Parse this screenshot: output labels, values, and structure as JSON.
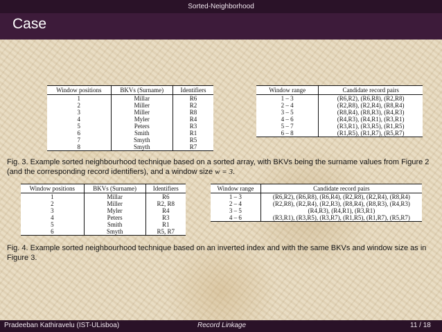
{
  "header": {
    "section": "Sorted-Neighborhood",
    "title": "Case"
  },
  "fig3": {
    "left_table": {
      "columns": [
        "Window positions",
        "BKVs (Surname)",
        "Identifiers"
      ],
      "rows": [
        [
          "1",
          "Millar",
          "R6"
        ],
        [
          "2",
          "Miller",
          "R2"
        ],
        [
          "3",
          "Miller",
          "R8"
        ],
        [
          "4",
          "Myler",
          "R4"
        ],
        [
          "5",
          "Peters",
          "R3"
        ],
        [
          "6",
          "Smith",
          "R1"
        ],
        [
          "7",
          "Smyth",
          "R5"
        ],
        [
          "8",
          "Smyth",
          "R7"
        ]
      ]
    },
    "right_table": {
      "columns": [
        "Window range",
        "Candidate record pairs"
      ],
      "rows": [
        [
          "1 – 3",
          "(R6,R2), (R6,R8), (R2,R8)"
        ],
        [
          "2 – 4",
          "(R2,R8), (R2,R4), (R8,R4)"
        ],
        [
          "3 – 5",
          "(R8,R4), (R8,R3), (R4,R3)"
        ],
        [
          "4 – 6",
          "(R4,R3), (R4,R1), (R3,R1)"
        ],
        [
          "5 – 7",
          "(R3,R1), (R3,R5), (R1,R5)"
        ],
        [
          "6 – 8",
          "(R1,R5), (R1,R7), (R5,R7)"
        ]
      ]
    },
    "caption_pre": "Fig. 3.  Example sorted neighbourhood technique based on a sorted array, with BKVs being the surname values from Figure 2 (and the corresponding record identifiers), and a window size ",
    "caption_math": "w = 3",
    "caption_post": "."
  },
  "fig4": {
    "left_table": {
      "columns": [
        "Window positions",
        "BKVs (Surname)",
        "Identifiers"
      ],
      "rows": [
        [
          "1",
          "Millar",
          "R6"
        ],
        [
          "2",
          "Miller",
          "R2, R8"
        ],
        [
          "3",
          "Myler",
          "R4"
        ],
        [
          "4",
          "Peters",
          "R3"
        ],
        [
          "5",
          "Smith",
          "R1"
        ],
        [
          "6",
          "Smyth",
          "R5, R7"
        ]
      ]
    },
    "right_table": {
      "columns": [
        "Window range",
        "Candidate record pairs"
      ],
      "rows": [
        [
          "1 – 3",
          "(R6,R2), (R6,R8), (R6,R4), (R2,R8), (R2,R4), (R8,R4)"
        ],
        [
          "2 – 4",
          "(R2,R8), (R2,R4), (R2,R3), (R8,R4), (R8,R3), (R4,R3)"
        ],
        [
          "3 – 5",
          "(R4,R3), (R4,R1), (R3,R1)"
        ],
        [
          "4 – 6",
          "(R3,R1), (R3,R5), (R3,R7), (R1,R5), (R1,R7), (R5,R7)"
        ]
      ]
    },
    "caption": "Fig. 4.  Example sorted neighbourhood technique based on an inverted index and with the same BKVs and window size as in Figure 3."
  },
  "footer": {
    "author": "Pradeeban Kathiravelu  (IST-ULisboa)",
    "topic": "Record Linkage",
    "page": "11 / 18"
  }
}
